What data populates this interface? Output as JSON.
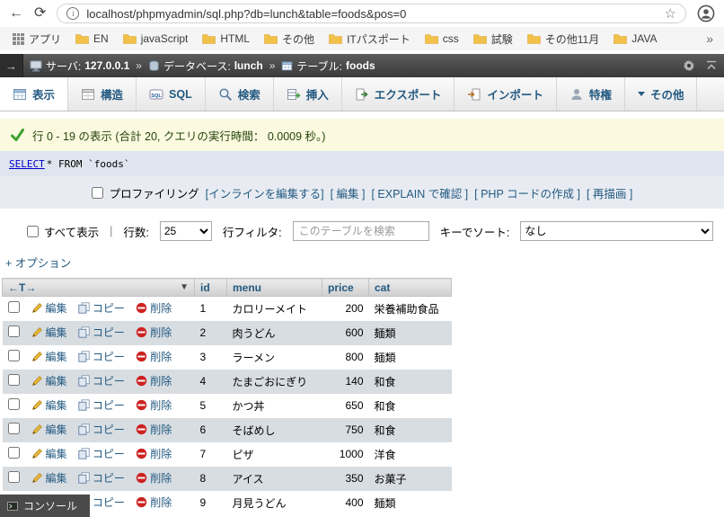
{
  "browser": {
    "icons": {
      "back": "←",
      "reload": "⟳",
      "star": "☆",
      "overflow": "»"
    },
    "url": "localhost/phpmyadmin/sql.php?db=lunch&table=foods&pos=0",
    "apps_label": "アプリ",
    "bookmarks": [
      {
        "label": "EN"
      },
      {
        "label": "javaScript"
      },
      {
        "label": "HTML"
      },
      {
        "label": "その他"
      },
      {
        "label": "ITパスポート"
      },
      {
        "label": "css"
      },
      {
        "label": "試験"
      },
      {
        "label": "その他11月"
      },
      {
        "label": "JAVA"
      }
    ]
  },
  "pma": {
    "breadcrumb": {
      "server_label": "サーバ:",
      "server_value": "127.0.0.1",
      "separator": "»",
      "db_label": "データベース:",
      "db_value": "lunch",
      "table_label": "テーブル:",
      "table_value": "foods"
    },
    "tabs": [
      {
        "label": "表示"
      },
      {
        "label": "構造"
      },
      {
        "label": "SQL"
      },
      {
        "label": "検索"
      },
      {
        "label": "挿入"
      },
      {
        "label": "エクスポート"
      },
      {
        "label": "インポート"
      },
      {
        "label": "特権"
      },
      {
        "label": "その他"
      }
    ],
    "result_message": "行 0 - 19 の表示 (合計 20, クエリの実行時間： 0.0009 秒。)",
    "sql": {
      "keyword": "SELECT",
      "rest": " * FROM `foods`"
    },
    "profiling": {
      "label": "プロファイリング",
      "inline_edit": "[インラインを編集する]",
      "edit": "[ 編集 ]",
      "explain": "[ EXPLAIN で確認 ]",
      "php_code": "[ PHP コードの作成 ]",
      "refresh": "[ 再描画 ]"
    },
    "controls": {
      "show_all": "すべて表示",
      "separator": "|",
      "num_rows_label": "行数:",
      "num_rows_value": "25",
      "filter_label": "行フィルタ:",
      "filter_placeholder": "このテーブルを検索",
      "sort_label": "キーでソート:",
      "sort_value": "なし"
    },
    "options_toggle": "+ オプション",
    "grid": {
      "corner": "←T→",
      "sort_caret": "▼",
      "columns": [
        "id",
        "menu",
        "price",
        "cat"
      ],
      "actions": {
        "edit": "編集",
        "copy": "コピー",
        "delete": "削除"
      },
      "rows": [
        {
          "id": "1",
          "menu": "カロリーメイト",
          "price": "200",
          "cat": "栄養補助食品"
        },
        {
          "id": "2",
          "menu": "肉うどん",
          "price": "600",
          "cat": "麺類"
        },
        {
          "id": "3",
          "menu": "ラーメン",
          "price": "800",
          "cat": "麺類"
        },
        {
          "id": "4",
          "menu": "たまごおにぎり",
          "price": "140",
          "cat": "和食"
        },
        {
          "id": "5",
          "menu": "かつ丼",
          "price": "650",
          "cat": "和食"
        },
        {
          "id": "6",
          "menu": "そばめし",
          "price": "750",
          "cat": "和食"
        },
        {
          "id": "7",
          "menu": "ピザ",
          "price": "1000",
          "cat": "洋食"
        },
        {
          "id": "8",
          "menu": "アイス",
          "price": "350",
          "cat": "お菓子"
        },
        {
          "id": "9",
          "menu": "月見うどん",
          "price": "400",
          "cat": "麺類"
        }
      ]
    },
    "console_label": "コンソール"
  },
  "colors": {
    "link_blue": "#235a81",
    "row_alt": "#d8dde2",
    "success_green": "#3da32d",
    "bar_dark": "#3a3a3a"
  }
}
